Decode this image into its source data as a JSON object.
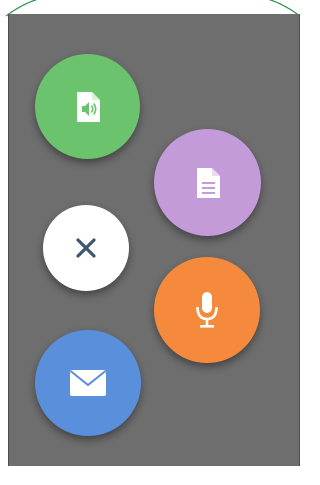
{
  "actions": {
    "audio_file": {
      "icon": "audio-file-icon",
      "color": "#6cc36d"
    },
    "document": {
      "icon": "document-icon",
      "color": "#c49bd9"
    },
    "close": {
      "icon": "close-icon",
      "color": "#ffffff",
      "icon_color": "#3f5670"
    },
    "voice": {
      "icon": "microphone-icon",
      "color": "#f58a3c"
    },
    "email": {
      "icon": "envelope-icon",
      "color": "#5a8fdc"
    }
  }
}
